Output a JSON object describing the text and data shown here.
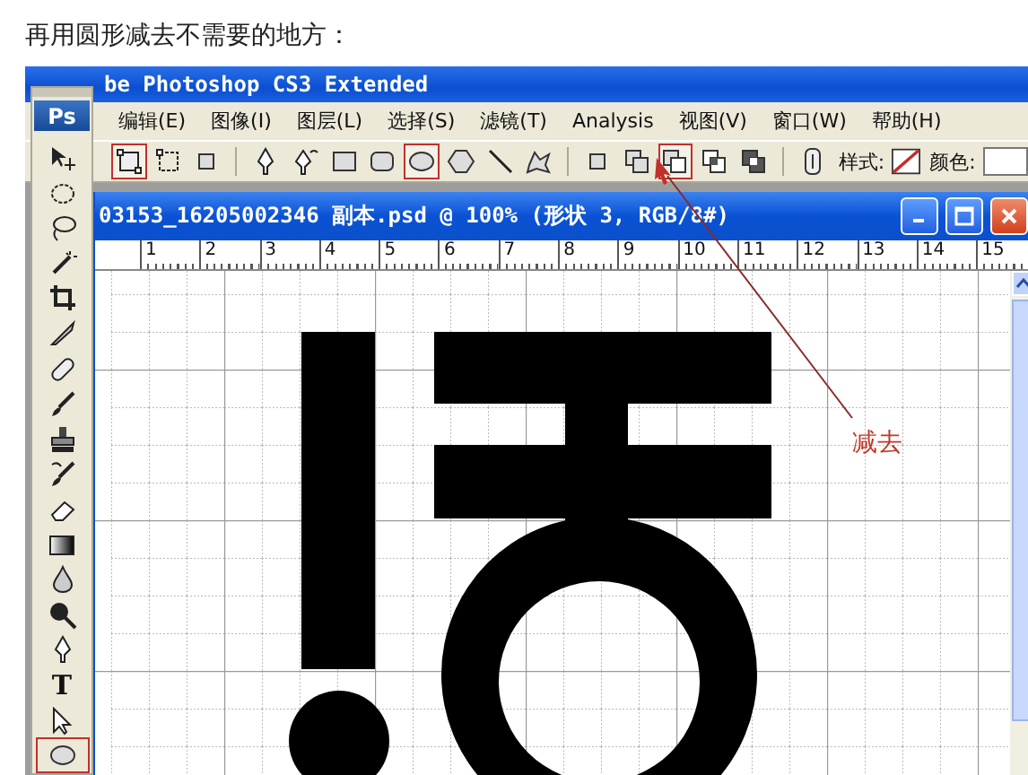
{
  "caption": "再用圆形减去不需要的地方：",
  "app": {
    "title": "be Photoshop CS3 Extended",
    "logo": "Ps"
  },
  "menu": [
    {
      "label": "编辑(E)"
    },
    {
      "label": "图像(I)"
    },
    {
      "label": "图层(L)"
    },
    {
      "label": "选择(S)"
    },
    {
      "label": "滤镜(T)"
    },
    {
      "label": "Analysis"
    },
    {
      "label": "视图(V)"
    },
    {
      "label": "窗口(W)"
    },
    {
      "label": "帮助(H)"
    }
  ],
  "options_bar": {
    "tools": [
      {
        "kind": "shape-layers",
        "selected": true
      },
      {
        "kind": "paths",
        "selected": false
      },
      {
        "kind": "fill-pixels",
        "selected": false
      },
      {
        "kind": "pen",
        "selected": false
      },
      {
        "kind": "freeform-pen",
        "selected": false
      },
      {
        "kind": "rectangle",
        "selected": false
      },
      {
        "kind": "rounded-rectangle",
        "selected": false
      },
      {
        "kind": "ellipse",
        "selected": true
      },
      {
        "kind": "polygon",
        "selected": false
      },
      {
        "kind": "line",
        "selected": false
      },
      {
        "kind": "custom-shape",
        "selected": false
      },
      {
        "kind": "new-area",
        "selected": false
      },
      {
        "kind": "add-area",
        "selected": false
      },
      {
        "kind": "subtract-area",
        "selected": true
      },
      {
        "kind": "intersect-area",
        "selected": false
      },
      {
        "kind": "exclude-area",
        "selected": false
      },
      {
        "kind": "link",
        "selected": false
      }
    ],
    "style_label": "样式:",
    "color_label": "颜色:"
  },
  "toolbox": {
    "tools": [
      {
        "kind": "move",
        "selected": false
      },
      {
        "kind": "elliptical-marquee",
        "selected": false
      },
      {
        "kind": "lasso",
        "selected": false
      },
      {
        "kind": "magic-wand",
        "selected": false
      },
      {
        "kind": "crop",
        "selected": false
      },
      {
        "kind": "slice",
        "selected": false
      },
      {
        "kind": "healing",
        "selected": false
      },
      {
        "kind": "brush",
        "selected": false
      },
      {
        "kind": "stamp",
        "selected": false
      },
      {
        "kind": "history-brush",
        "selected": false
      },
      {
        "kind": "eraser",
        "selected": false
      },
      {
        "kind": "gradient",
        "selected": false
      },
      {
        "kind": "blur",
        "selected": false
      },
      {
        "kind": "dodge",
        "selected": false
      },
      {
        "kind": "pen",
        "selected": false
      },
      {
        "kind": "type",
        "text": "T",
        "selected": false
      },
      {
        "kind": "path-select",
        "selected": false
      },
      {
        "kind": "ellipse",
        "selected": true
      }
    ]
  },
  "document": {
    "title": "03153_16205002346 副本.psd @ 100% (形状 3, RGB/8#)",
    "ruler": [
      "1",
      "2",
      "3",
      "4",
      "5",
      "6",
      "7",
      "8",
      "9",
      "10",
      "11",
      "12",
      "13",
      "14",
      "15"
    ]
  },
  "annotation": {
    "text": "减去"
  }
}
